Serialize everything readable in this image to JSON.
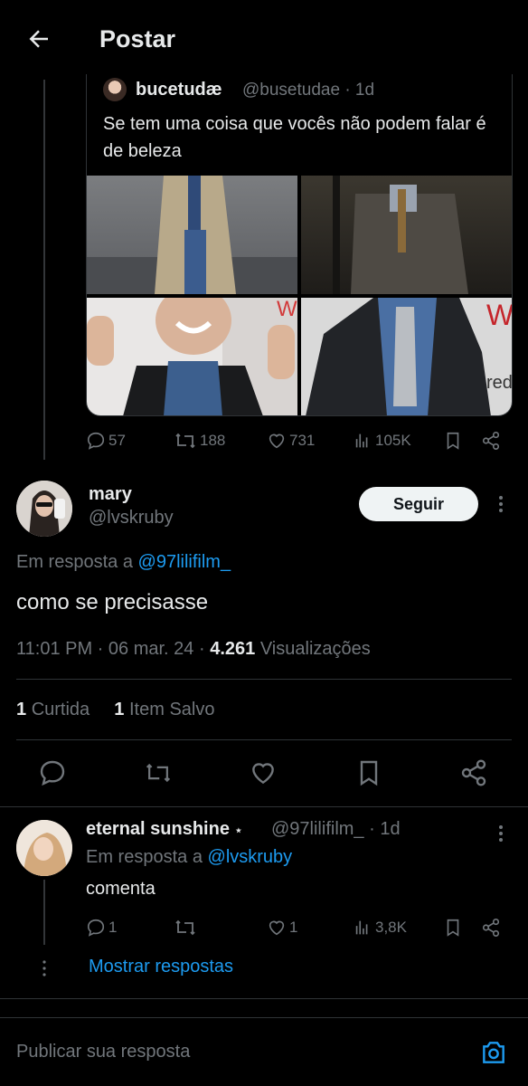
{
  "header": {
    "title": "Postar"
  },
  "quoted_post": {
    "author_name": "bucetudæ",
    "handle_time": "@busetudae · 1d",
    "text": "Se tem uma coisa que vocês não podem falar é de beleza",
    "replies": "57",
    "reposts": "188",
    "likes": "731",
    "views": "105K"
  },
  "post": {
    "author_name": "mary",
    "handle": "@lvskruby",
    "follow_label": "Seguir",
    "reply_prefix": "Em resposta a",
    "reply_to": "@97lilifilm_",
    "text": "como se precisasse",
    "time": "11:01 PM",
    "date": "06 mar. 24",
    "views_count": "4.261",
    "views_label": "Visualizações",
    "likes_count": "1",
    "likes_label": "Curtida",
    "saves_count": "1",
    "saves_label": "Item Salvo"
  },
  "reply": {
    "author_name": "eternal sunshine",
    "author_badge": "⋆",
    "handle_time": "@97lilifilm_ · 1d",
    "reply_prefix": "Em resposta a",
    "reply_to": "@lvskruby",
    "text": "comenta",
    "replies": "1",
    "likes": "1",
    "views": "3,8K",
    "show_replies": "Mostrar respostas"
  },
  "composer": {
    "placeholder": "Publicar sua resposta"
  },
  "colors": {
    "accent": "#1d9bf0",
    "background": "#000000",
    "muted": "#71767b",
    "text": "#e7e9ea"
  }
}
